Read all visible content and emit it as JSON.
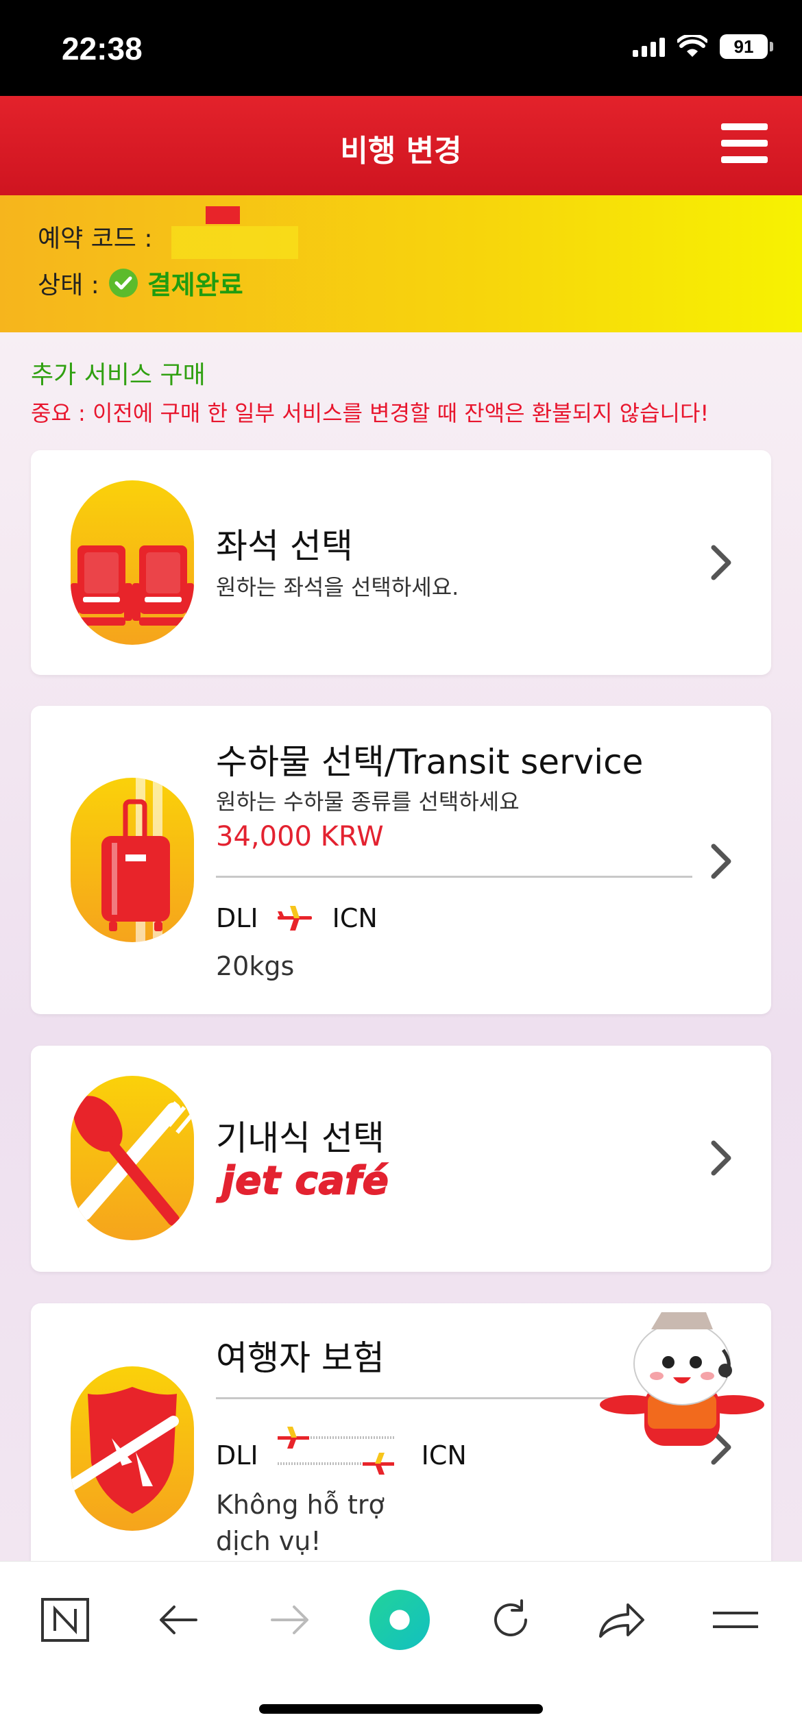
{
  "status_bar": {
    "time": "22:38",
    "battery": "91"
  },
  "header": {
    "title": "비행 변경",
    "menu_icon": "hamburger-menu-icon"
  },
  "booking": {
    "code_label": "예약 코드 :",
    "status_label": "상태 :",
    "status_value": "결제완료",
    "status_color": "#1f9c10"
  },
  "section": {
    "title": "추가 서비스 구매",
    "notice": "중요 : 이전에 구매 한 일부 서비스를 변경할 때 잔액은 환불되지 않습니다!"
  },
  "cards": {
    "seat": {
      "title": "좌석 선택",
      "subtitle": "원하는 좌석을 선택하세요.",
      "icon": "seat-icon"
    },
    "baggage": {
      "title": "수하물 선택/Transit service",
      "subtitle": "원하는 수하물 종류를 선택하세요",
      "price": "34,000 KRW",
      "from": "DLI",
      "to": "ICN",
      "weight": "20kgs",
      "icon": "luggage-icon"
    },
    "meal": {
      "title": "기내식 선택",
      "brand": "jet café",
      "icon": "spoon-fork-icon"
    },
    "insurance": {
      "title": "여행자 보험",
      "from": "DLI",
      "to": "ICN",
      "note_line1": "Không hỗ trợ",
      "note_line2": "dịch vụ!",
      "icon": "shield-plane-icon"
    }
  },
  "toolbar": {
    "items": [
      "naver-icon",
      "back-icon",
      "forward-icon",
      "home-circle-icon",
      "refresh-icon",
      "share-icon",
      "menu-icon"
    ]
  },
  "colors": {
    "brand_red": "#e32230",
    "accent_yellow": "#f7d50c",
    "notice_red": "#e8152d",
    "section_green": "#30a011"
  }
}
